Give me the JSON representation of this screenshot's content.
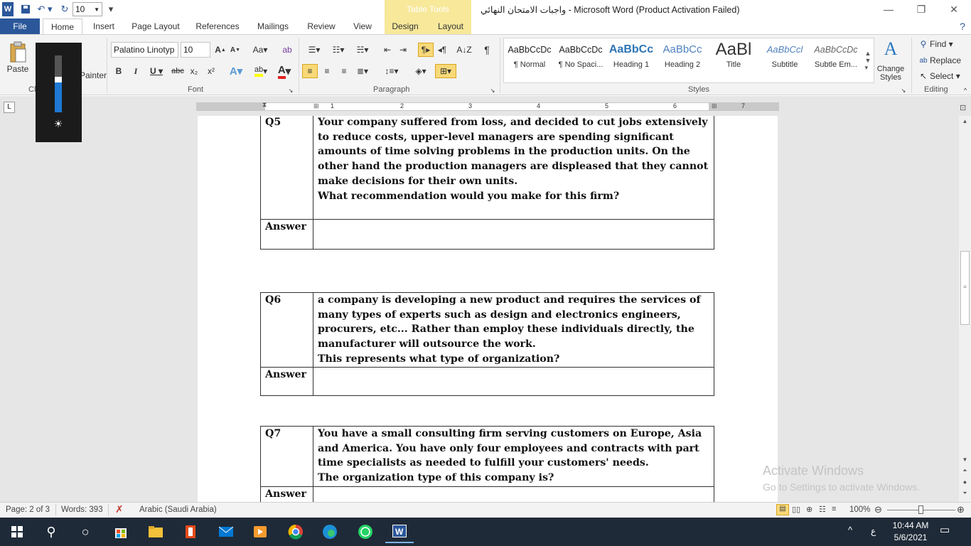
{
  "window": {
    "title": "واجبات الامتحان النهائي  -  Microsoft Word (Product Activation Failed)",
    "contextual_tab_group": "Table Tools",
    "font_size_qat": "10"
  },
  "tabs": [
    "File",
    "Home",
    "Insert",
    "Page Layout",
    "References",
    "Mailings",
    "Review",
    "View",
    "Design",
    "Layout"
  ],
  "ribbon": {
    "clipboard": {
      "paste": "Paste",
      "format_painter": "Painter",
      "label": "Cl"
    },
    "font": {
      "font_name": "Palatino Linotyp",
      "font_size": "10",
      "label": "Font"
    },
    "paragraph": {
      "label": "Paragraph"
    },
    "styles": {
      "label": "Styles",
      "items": [
        {
          "preview": "AaBbCcDc",
          "name": "¶ Normal"
        },
        {
          "preview": "AaBbCcDc",
          "name": "¶ No Spaci..."
        },
        {
          "preview": "AaBbCc",
          "name": "Heading 1"
        },
        {
          "preview": "AaBbCc",
          "name": "Heading 2"
        },
        {
          "preview": "AaBl",
          "name": "Title"
        },
        {
          "preview": "AaBbCcl",
          "name": "Subtitle"
        },
        {
          "preview": "AaBbCcDc",
          "name": "Subtle Em..."
        }
      ],
      "change_styles": "Change Styles"
    },
    "editing": {
      "find": "Find",
      "replace": "Replace",
      "select": "Select",
      "label": "Editing"
    }
  },
  "ruler_numbers": [
    "1",
    "1",
    "2",
    "3",
    "4",
    "5",
    "6",
    "7"
  ],
  "document": {
    "questions": [
      {
        "key": "Q5",
        "lines": [
          "Your company suffered from loss, and decided to cut jobs extensively",
          "to reduce costs, upper-level managers are spending significant",
          "amounts  of time solving problems in the production units. On the",
          "other hand the production managers are displeased that they cannot",
          "make decisions for their own units.",
          "What recommendation would you make for this firm?"
        ],
        "answer_label": "Answer",
        "answer": ""
      },
      {
        "key": "Q6",
        "lines": [
          "a company is developing a new product and requires the services of",
          "many types of experts such as design and electronics engineers,",
          "procurers, etc... Rather than employ these individuals  directly, the",
          "manufacturer  will outsource the work.",
          "This represents what type of organization?"
        ],
        "answer_label": "Answer",
        "answer": ""
      },
      {
        "key": "Q7",
        "lines": [
          "You have a small consulting firm serving customers on Europe, Asia",
          "and America. You have only four employees and contracts with part",
          "time specialists as needed to fulfill your customers' needs.",
          "The organization type of this company is?"
        ],
        "answer_label": "Answer",
        "answer": ""
      }
    ]
  },
  "watermark": {
    "line1": "Activate Windows",
    "line2": "Go to Settings to activate Windows."
  },
  "status": {
    "page": "Page: 2 of 3",
    "words": "Words: 393",
    "language": "Arabic (Saudi Arabia)",
    "zoom": "100%"
  },
  "taskbar": {
    "time": "10:44 AM",
    "date": "5/6/2021",
    "lang": "ع"
  },
  "colors": {
    "word_blue": "#2b579a",
    "table_tools": "#f7e89a",
    "taskbar": "#1f2a38"
  }
}
